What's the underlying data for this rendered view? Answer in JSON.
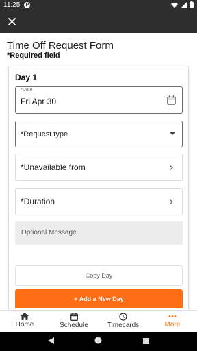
{
  "status_bar": {
    "time": "11:25",
    "app_icon_letter": "P"
  },
  "header": {
    "close_icon": "close-icon"
  },
  "form": {
    "title": "Time Off Request Form",
    "required_note": "*Required field"
  },
  "day": {
    "title": "Day 1",
    "date_label": "*Date",
    "date_value": "Fri Apr 30",
    "request_type_placeholder": "*Request type",
    "unavailable_from_label": "*Unavailable from",
    "duration_label": "*Duration",
    "message_placeholder": "Optional Message",
    "copy_day_label": "Copy Day",
    "add_day_label": "+ Add a New Day"
  },
  "bottom_nav": {
    "items": [
      {
        "label": "Home",
        "icon": "home-icon"
      },
      {
        "label": "Schedule",
        "icon": "calendar-icon"
      },
      {
        "label": "Timecards",
        "icon": "clock-icon"
      },
      {
        "label": "More",
        "icon": "more-dots-icon"
      }
    ],
    "active_index": 3
  },
  "colors": {
    "accent": "#ff6d14",
    "app_bar": "#2e2e2e"
  }
}
